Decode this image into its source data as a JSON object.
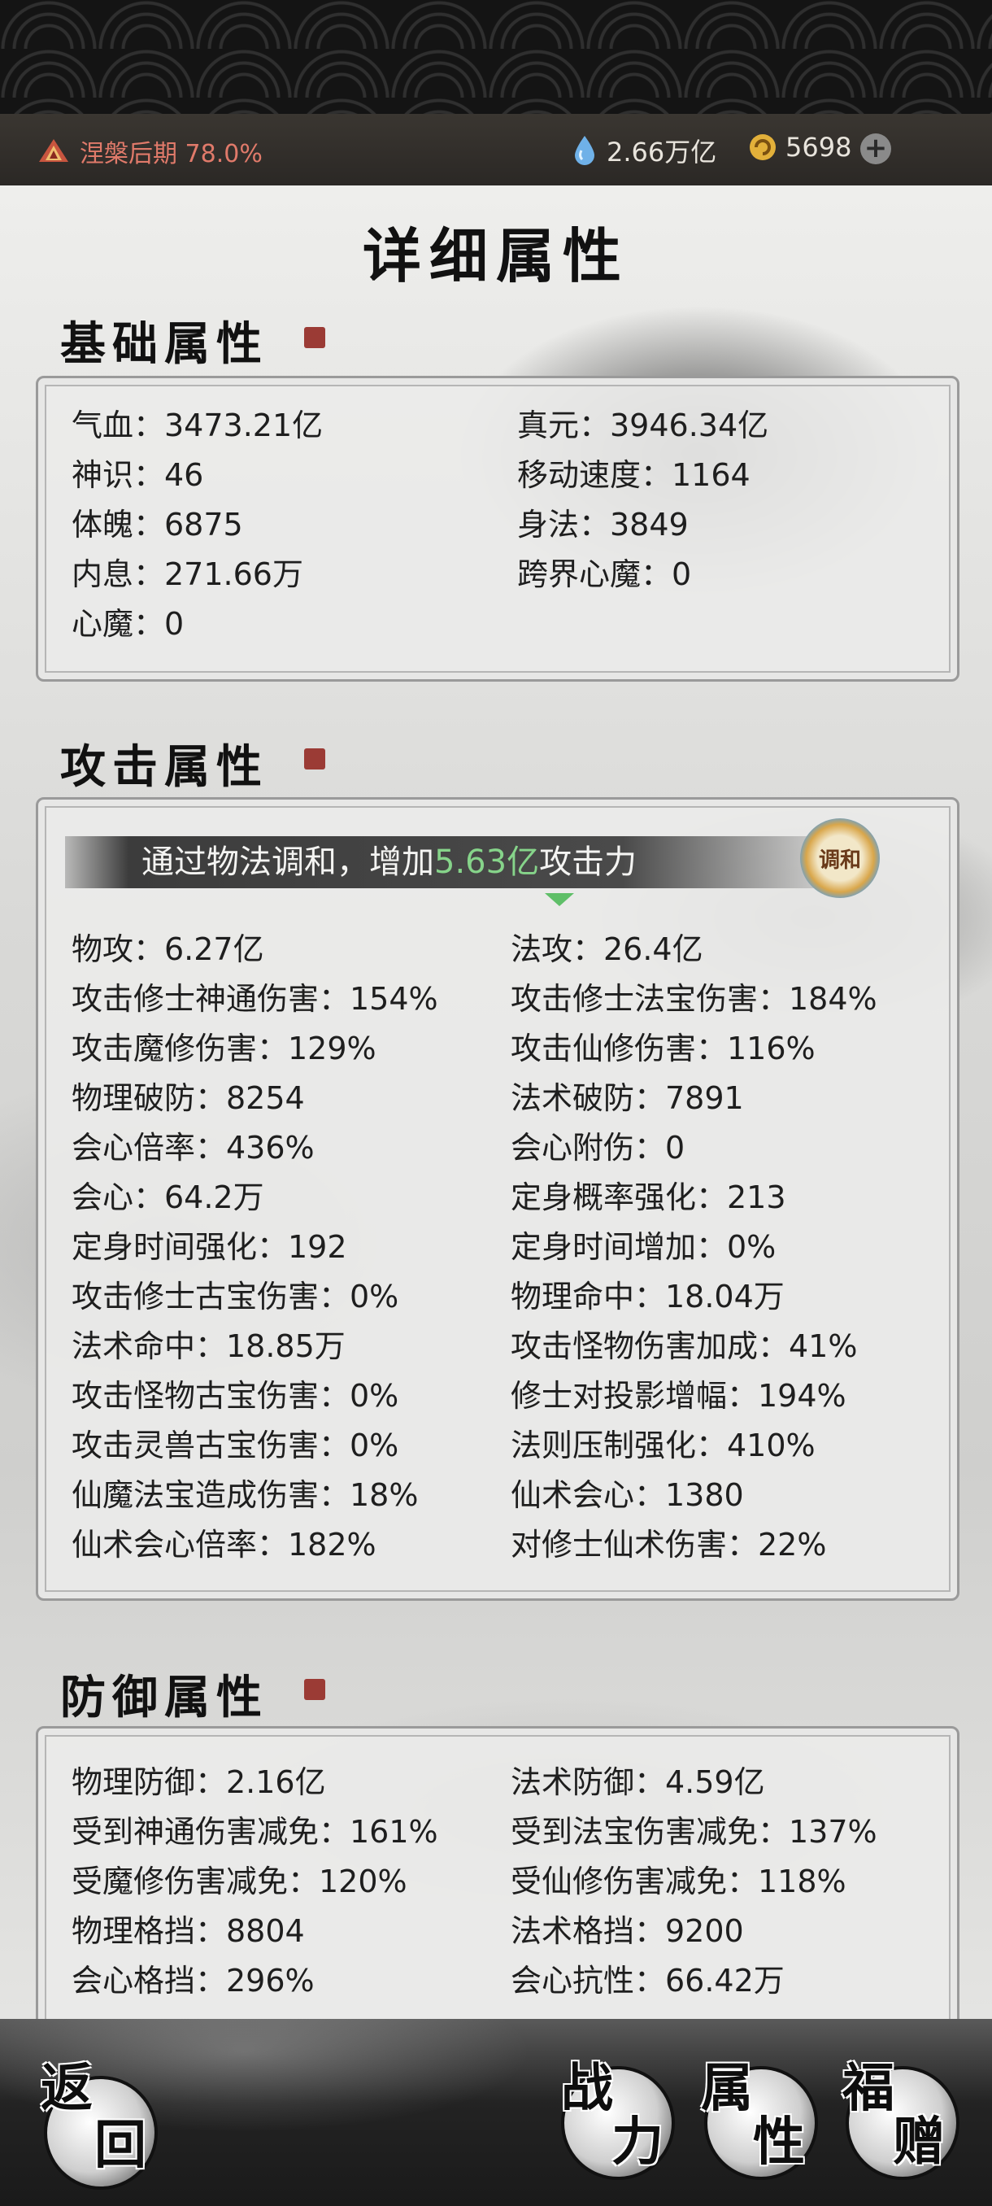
{
  "status": {
    "realm_label": "涅槃后期 78.0%",
    "currency1": "2.66万亿",
    "currency2": "5698",
    "plus": "+"
  },
  "page_title": "详细属性",
  "sections": {
    "basic": {
      "title": "基础属性",
      "rows": [
        [
          "气血：3473.21亿",
          "真元：3946.34亿"
        ],
        [
          "神识：46",
          "移动速度：1164"
        ],
        [
          "体魄：6875",
          "身法：3849"
        ],
        [
          "内息：271.66万",
          "跨界心魔：0"
        ],
        [
          "心魔：0",
          ""
        ]
      ]
    },
    "attack": {
      "title": "攻击属性",
      "banner_prefix": "通过物法调和，增加",
      "banner_highlight": "5.63亿",
      "banner_suffix": "攻击力",
      "badge": "调和",
      "rows": [
        [
          "物攻：6.27亿",
          "法攻：26.4亿"
        ],
        [
          "攻击修士神通伤害：154%",
          "攻击修士法宝伤害：184%"
        ],
        [
          "攻击魔修伤害：129%",
          "攻击仙修伤害：116%"
        ],
        [
          "物理破防：8254",
          "法术破防：7891"
        ],
        [
          "会心倍率：436%",
          "会心附伤：0"
        ],
        [
          "会心：64.2万",
          "定身概率强化：213"
        ],
        [
          "定身时间强化：192",
          "定身时间增加：0%"
        ],
        [
          "攻击修士古宝伤害：0%",
          "物理命中：18.04万"
        ],
        [
          "法术命中：18.85万",
          "攻击怪物伤害加成：41%"
        ],
        [
          "攻击怪物古宝伤害：0%",
          "修士对投影增幅：194%"
        ],
        [
          "攻击灵兽古宝伤害：0%",
          "法则压制强化：410%"
        ],
        [
          "仙魔法宝造成伤害：18%",
          "仙术会心：1380"
        ],
        [
          "仙术会心倍率：182%",
          "对修士仙术伤害：22%"
        ]
      ]
    },
    "defense": {
      "title": "防御属性",
      "rows": [
        [
          "物理防御：2.16亿",
          "法术防御：4.59亿"
        ],
        [
          "受到神通伤害减免：161%",
          "受到法宝伤害减免：137%"
        ],
        [
          "受魔修伤害减免：120%",
          "受仙修伤害减免：118%"
        ],
        [
          "物理格挡：8804",
          "法术格挡：9200"
        ],
        [
          "会心格挡：296%",
          "会心抗性：66.42万"
        ]
      ]
    }
  },
  "nav": {
    "back": [
      "返",
      "回"
    ],
    "power": [
      "战",
      "力"
    ],
    "attrs": [
      "属",
      "性"
    ],
    "gift": [
      "福",
      "赠"
    ]
  },
  "colors": {
    "realm": "#e07a6a",
    "highlight": "#86d48a",
    "seal": "#9b3b35"
  }
}
